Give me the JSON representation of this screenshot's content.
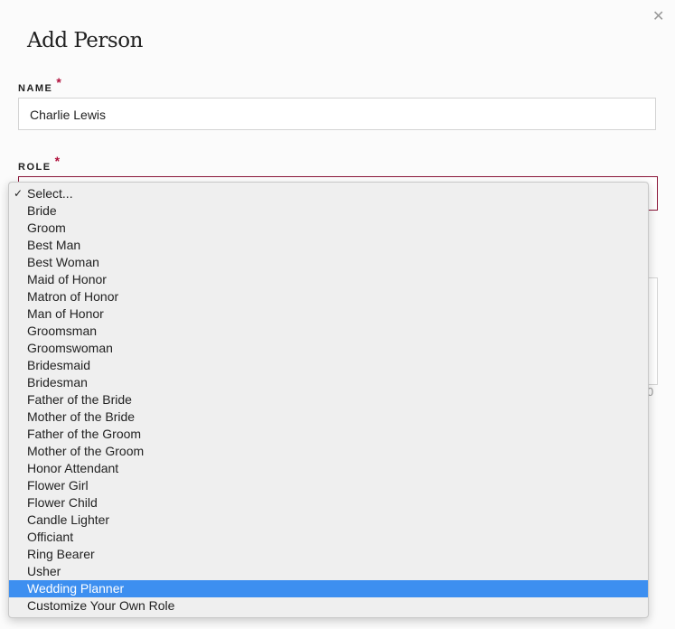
{
  "dialog": {
    "title": "Add Person",
    "close_icon": "close-icon"
  },
  "name_field": {
    "label": "NAME",
    "required": "*",
    "value": "Charlie Lewis"
  },
  "role_field": {
    "label": "ROLE",
    "required": "*"
  },
  "char_count": "0",
  "colors": {
    "accent": "#8a1538",
    "required": "#b0103c",
    "highlight": "#3d8ff0"
  },
  "dropdown": {
    "checked_index": 0,
    "highlighted_index": 23,
    "options": [
      "Select...",
      "Bride",
      "Groom",
      "Best Man",
      "Best Woman",
      "Maid of Honor",
      "Matron of Honor",
      "Man of Honor",
      "Groomsman",
      "Groomswoman",
      "Bridesmaid",
      "Bridesman",
      "Father of the Bride",
      "Mother of the Bride",
      "Father of the Groom",
      "Mother of the Groom",
      "Honor Attendant",
      "Flower Girl",
      "Flower Child",
      "Candle Lighter",
      "Officiant",
      "Ring Bearer",
      "Usher",
      "Wedding Planner",
      "Customize Your Own Role"
    ]
  }
}
